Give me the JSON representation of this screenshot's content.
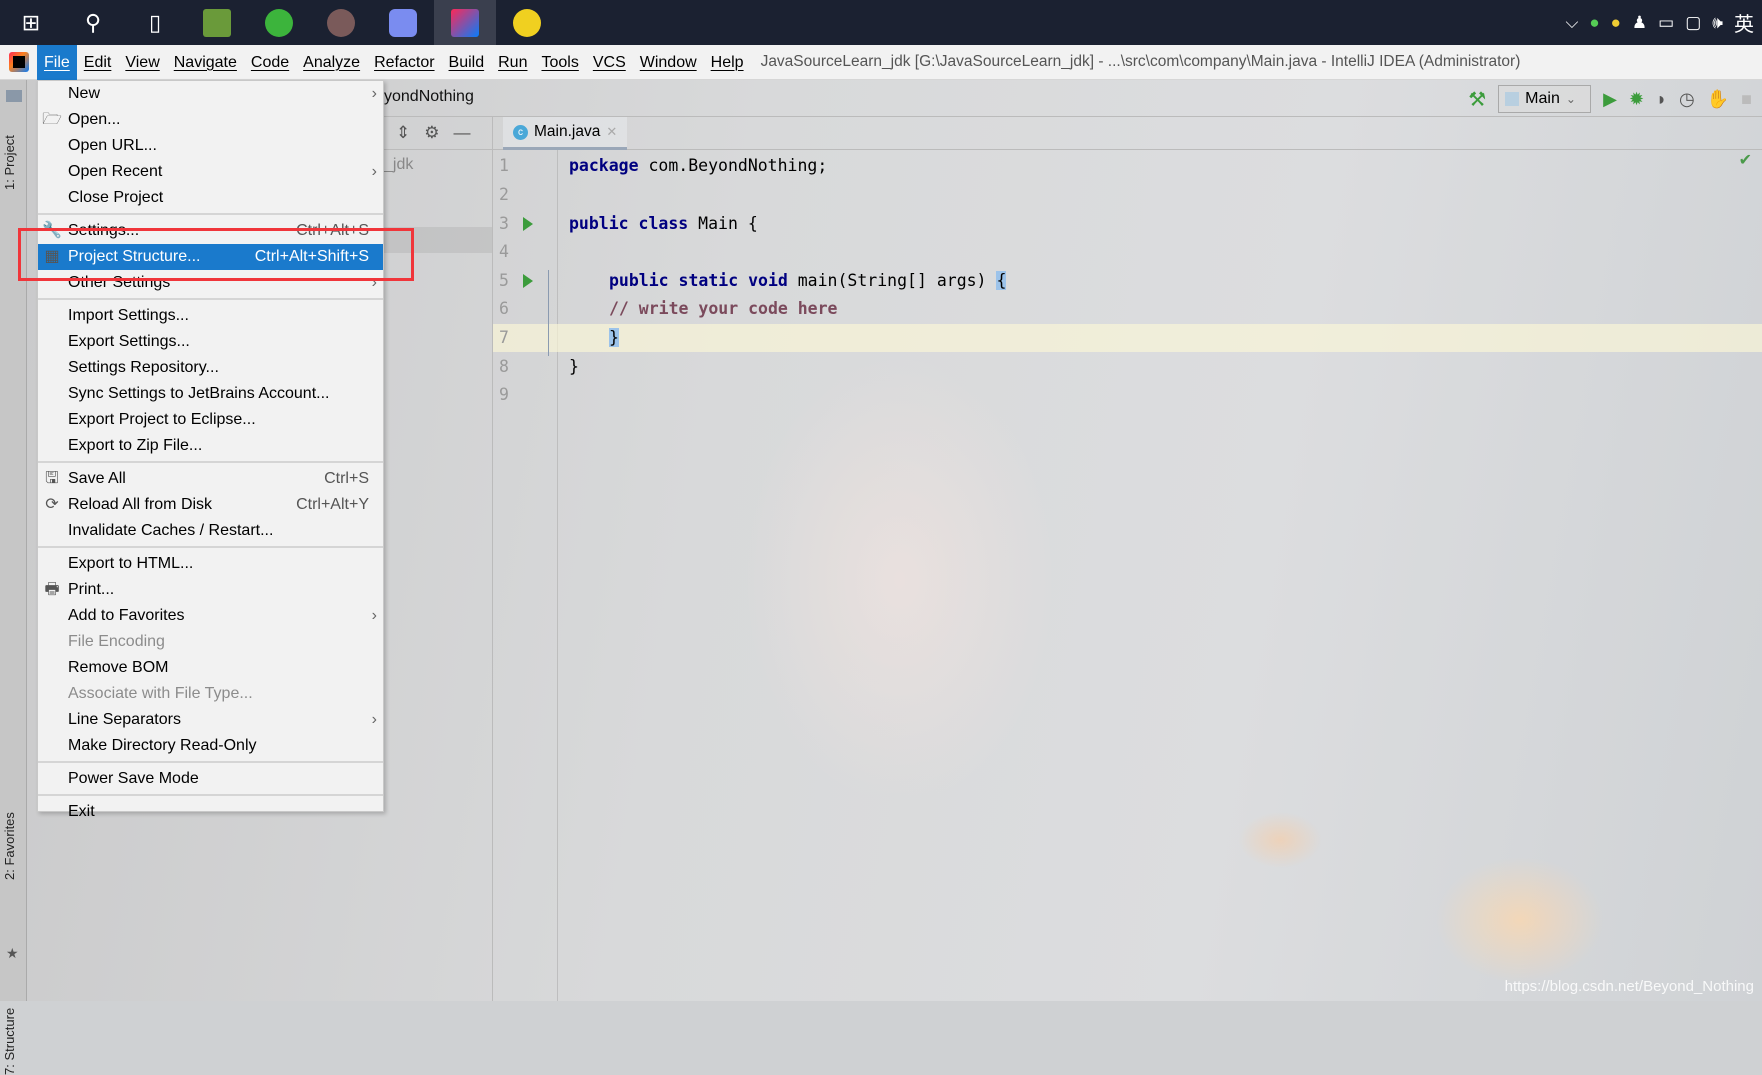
{
  "taskbar": {
    "icons": [
      "windows-start-icon",
      "search-icon",
      "task-view-icon",
      "notepad-icon",
      "browser-icon",
      "app-icon",
      "photos-icon",
      "intellij-icon",
      "music-icon"
    ],
    "tray": [
      "chevron-up-icon",
      "browser-tray-icon",
      "security-tray-icon",
      "qq-icon",
      "battery-icon",
      "network-icon",
      "volume-icon"
    ],
    "ime": "英"
  },
  "menubar": {
    "items": [
      "File",
      "Edit",
      "View",
      "Navigate",
      "Code",
      "Analyze",
      "Refactor",
      "Build",
      "Run",
      "Tools",
      "VCS",
      "Window",
      "Help"
    ],
    "title": "JavaSourceLearn_jdk [G:\\JavaSourceLearn_jdk] - ...\\src\\com\\company\\Main.java - IntelliJ IDEA (Administrator)"
  },
  "nav": {
    "breadcrumb": "yondNothing",
    "run_config": "Main"
  },
  "project": {
    "root_fragment": "_jdk"
  },
  "tool_windows": {
    "project": "1: Project",
    "favorites": "2: Favorites",
    "structure": "7: Structure"
  },
  "editor": {
    "tab": "Main.java",
    "lines": [
      "1",
      "2",
      "3",
      "4",
      "5",
      "6",
      "7",
      "8",
      "9"
    ],
    "code": {
      "l1_kw": "package",
      "l1": " com.BeyondNothing;",
      "l3_kw": "public class",
      "l3": " Main {",
      "l5_kw": "public static void",
      "l5": " main(String[] args) ",
      "l5_brace": "{",
      "l6": "// write your code here",
      "l7": "}",
      "l8": "}"
    },
    "current_line": 7
  },
  "file_menu": {
    "groups": [
      [
        {
          "label": "New",
          "arrow": true
        },
        {
          "label": "Open...",
          "icon": "folder-open-icon"
        },
        {
          "label": "Open URL..."
        },
        {
          "label": "Open Recent",
          "arrow": true
        },
        {
          "label": "Close Project"
        }
      ],
      [
        {
          "label": "Settings...",
          "shortcut": "Ctrl+Alt+S",
          "icon": "wrench-icon"
        },
        {
          "label": "Project Structure...",
          "shortcut": "Ctrl+Alt+Shift+S",
          "icon": "project-structure-icon",
          "selected": true
        },
        {
          "label": "Other Settings",
          "arrow": true
        }
      ],
      [
        {
          "label": "Import Settings..."
        },
        {
          "label": "Export Settings..."
        },
        {
          "label": "Settings Repository..."
        },
        {
          "label": "Sync Settings to JetBrains Account..."
        },
        {
          "label": "Export Project to Eclipse..."
        },
        {
          "label": "Export to Zip File..."
        }
      ],
      [
        {
          "label": "Save All",
          "shortcut": "Ctrl+S",
          "icon": "save-icon"
        },
        {
          "label": "Reload All from Disk",
          "shortcut": "Ctrl+Alt+Y",
          "icon": "reload-icon"
        },
        {
          "label": "Invalidate Caches / Restart..."
        }
      ],
      [
        {
          "label": "Export to HTML..."
        },
        {
          "label": "Print...",
          "icon": "print-icon"
        },
        {
          "label": "Add to Favorites",
          "arrow": true
        },
        {
          "label": "File Encoding",
          "disabled": true
        },
        {
          "label": "Remove BOM"
        },
        {
          "label": "Associate with File Type...",
          "disabled": true
        },
        {
          "label": "Line Separators",
          "arrow": true
        },
        {
          "label": "Make Directory Read-Only"
        }
      ],
      [
        {
          "label": "Power Save Mode"
        }
      ],
      [
        {
          "label": "Exit"
        }
      ]
    ]
  },
  "watermark": "https://blog.csdn.net/Beyond_Nothing",
  "colors": {
    "accent": "#1a7acc",
    "highlight_box": "#f0353a",
    "keyword": "#000080",
    "taskbar": "#1b2131"
  }
}
